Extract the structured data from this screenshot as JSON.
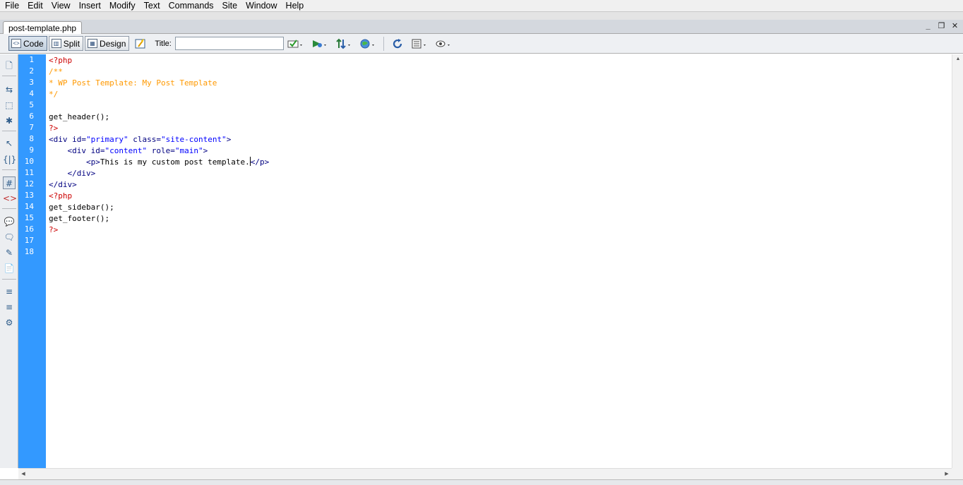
{
  "menubar": {
    "items": [
      "File",
      "Edit",
      "View",
      "Insert",
      "Modify",
      "Text",
      "Commands",
      "Site",
      "Window",
      "Help"
    ]
  },
  "document": {
    "tab_label": "post-template.php",
    "window_controls": {
      "minimize": "_",
      "restore": "❐",
      "close": "✕"
    }
  },
  "toolbar": {
    "code_label": "Code",
    "split_label": "Split",
    "design_label": "Design",
    "title_label": "Title:",
    "title_value": "",
    "icons": [
      "live-code-icon",
      "validate-icon",
      "preview-icon",
      "file-management-icon",
      "browser-check-icon",
      "refresh-icon",
      "view-options-icon",
      "visual-aids-icon"
    ]
  },
  "coding_toolbar": {
    "icons": [
      "open-documents-icon",
      "collapse-full-tag-icon",
      "collapse-selection-icon",
      "expand-all-icon",
      "select-parent-tag-icon",
      "balance-braces-icon",
      "line-numbers-icon",
      "highlight-invalid-code-icon",
      "apply-comment-icon",
      "remove-comment-icon",
      "wrap-tag-icon",
      "recent-snippets-icon",
      "indent-code-icon",
      "outdent-code-icon",
      "format-source-icon"
    ]
  },
  "editor": {
    "line_numbers": [
      "1",
      "2",
      "3",
      "4",
      "5",
      "6",
      "7",
      "8",
      "9",
      "10",
      "11",
      "12",
      "13",
      "14",
      "15",
      "16",
      "17",
      "18"
    ],
    "l1": "<?php",
    "l2": "/**",
    "l3": "* WP Post Template: My Post Template",
    "l4": "*/",
    "l5": "",
    "l6": "get_header();",
    "l7": "?>",
    "l8": {
      "open": "<div ",
      "a1": "id=",
      "v1": "\"primary\"",
      "a2": " class=",
      "v2": "\"site-content\"",
      "close": ">"
    },
    "l9": {
      "indent": "    ",
      "open": "<div ",
      "a1": "id=",
      "v1": "\"content\"",
      "a2": " role=",
      "v2": "\"main\"",
      "close": ">"
    },
    "l10": {
      "indent": "        ",
      "open": "<p>",
      "text": "This is my custom post template.",
      "close": "</p>"
    },
    "l11": {
      "indent": "    ",
      "tag": "</div>"
    },
    "l12": "</div>",
    "l13": "<?php",
    "l14": "get_sidebar();",
    "l15": "get_footer();",
    "l16": "?>",
    "l17": "",
    "l18": ""
  },
  "colors": {
    "gutter": "#3399ff",
    "php_delimiter": "#cc0000",
    "comment": "#ff9900",
    "tag": "#000080",
    "attr_value": "#0000ff"
  }
}
